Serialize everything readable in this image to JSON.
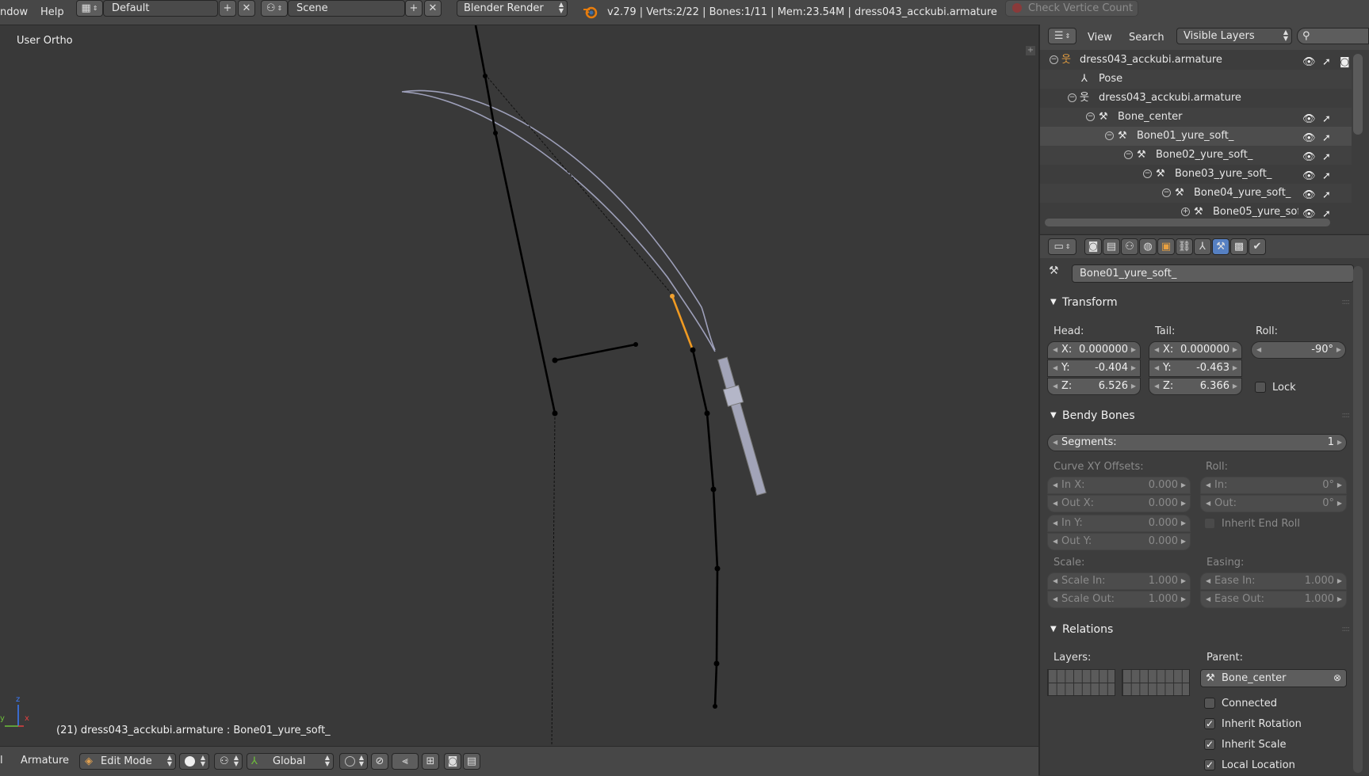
{
  "topbar": {
    "menu_window": "ndow",
    "menu_help": "Help",
    "screen_layout": "Default",
    "scene": "Scene",
    "render_engine": "Blender Render",
    "stats": "v2.79 | Verts:2/22 | Bones:1/11 | Mem:23.54M | dress043_acckubi.armature",
    "check_vertex_count": "Check Vertice Count"
  },
  "viewport": {
    "view_label": "User Ortho",
    "status": "(21) dress043_acckubi.armature : Bone01_yure_soft_",
    "axis_x": "x",
    "axis_y": "y",
    "axis_z": "z"
  },
  "bottombar": {
    "menu_left": "l",
    "menu_armature": "Armature",
    "mode": "Edit Mode",
    "orientation": "Global"
  },
  "outliner": {
    "view": "View",
    "search": "Search",
    "display_mode": "Visible Layers",
    "rows": [
      {
        "label": "dress043_acckubi.armature"
      },
      {
        "label": "Pose"
      },
      {
        "label": "dress043_acckubi.armature"
      },
      {
        "label": "Bone_center"
      },
      {
        "label": "Bone01_yure_soft_"
      },
      {
        "label": "Bone02_yure_soft_"
      },
      {
        "label": "Bone03_yure_soft_"
      },
      {
        "label": "Bone04_yure_soft_"
      },
      {
        "label": "Bone05_yure_sof"
      }
    ]
  },
  "properties": {
    "bone_name": "Bone01_yure_soft_",
    "transform": {
      "title": "Transform",
      "head_label": "Head:",
      "tail_label": "Tail:",
      "roll_label": "Roll:",
      "head": {
        "x_label": "X:",
        "x": "0.000000",
        "y_label": "Y:",
        "y": "-0.404",
        "z_label": "Z:",
        "z": "6.526"
      },
      "tail": {
        "x_label": "X:",
        "x": "0.000000",
        "y_label": "Y:",
        "y": "-0.463",
        "z_label": "Z:",
        "z": "6.366"
      },
      "roll": "-90°",
      "lock": "Lock"
    },
    "bendy": {
      "title": "Bendy Bones",
      "segments_label": "Segments:",
      "segments": "1",
      "curve_label": "Curve XY Offsets:",
      "roll_label": "Roll:",
      "in_x_label": "In X:",
      "in_x": "0.000",
      "out_x_label": "Out X:",
      "out_x": "0.000",
      "in_y_label": "In Y:",
      "in_y": "0.000",
      "out_y_label": "Out Y:",
      "out_y": "0.000",
      "roll_in_label": "In:",
      "roll_in": "0°",
      "roll_out_label": "Out:",
      "roll_out": "0°",
      "inherit_end_roll": "Inherit End Roll",
      "scale_label": "Scale:",
      "easing_label": "Easing:",
      "scale_in_label": "Scale In:",
      "scale_in": "1.000",
      "scale_out_label": "Scale Out:",
      "scale_out": "1.000",
      "ease_in_label": "Ease In:",
      "ease_in": "1.000",
      "ease_out_label": "Ease Out:",
      "ease_out": "1.000"
    },
    "relations": {
      "title": "Relations",
      "layers_label": "Layers:",
      "parent_label": "Parent:",
      "parent": "Bone_center",
      "connected": "Connected",
      "inherit_rotation": "Inherit Rotation",
      "inherit_scale": "Inherit Scale",
      "local_location": "Local Location"
    }
  }
}
